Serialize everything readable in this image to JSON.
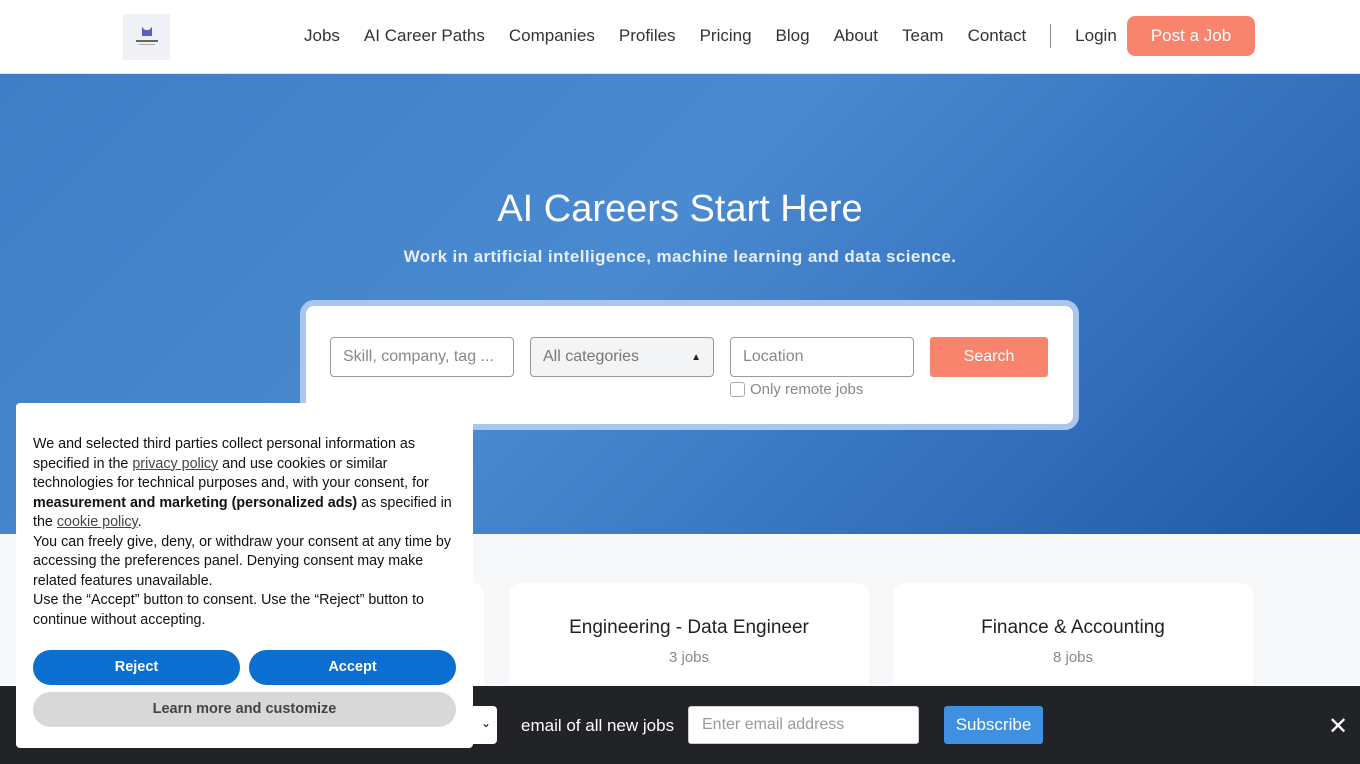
{
  "nav": {
    "items": [
      "Jobs",
      "AI Career Paths",
      "Companies",
      "Profiles",
      "Pricing",
      "Blog",
      "About",
      "Team",
      "Contact"
    ],
    "login": "Login",
    "post_job": "Post a Job",
    "logo_text": "GETINAI"
  },
  "hero": {
    "title": "AI Careers Start Here",
    "subtitle": "Work in artificial intelligence, machine learning and data science."
  },
  "search": {
    "skill_placeholder": "Skill, company, tag ...",
    "category": "All categories",
    "location_placeholder": "Location",
    "remote_label": "Only remote jobs",
    "button": "Search"
  },
  "categories": [
    {
      "title": "Engineering - Data Engineer",
      "count": "3 jobs"
    },
    {
      "title": "Finance & Accounting",
      "count": "8 jobs"
    }
  ],
  "subscribe": {
    "text": "email of all new jobs",
    "email_placeholder": "Enter email address",
    "button": "Subscribe"
  },
  "cookie": {
    "p1a": "We and selected third parties collect personal information as specified in the ",
    "privacy_link": "privacy policy",
    "p1b": " and use cookies or similar technologies for technical purposes and, with your consent, for ",
    "bold": "measurement and marketing (personalized ads)",
    "p1c": " as specified in the ",
    "cookie_link": "cookie policy",
    "p1d": ".",
    "p2": "You can freely give, deny, or withdraw your consent at any time by accessing the preferences panel. Denying consent may make related features unavailable.",
    "p3": "Use the “Accept” button to consent. Use the “Reject” button to continue without accepting.",
    "reject": "Reject",
    "accept": "Accept",
    "learn": "Learn more and customize"
  }
}
